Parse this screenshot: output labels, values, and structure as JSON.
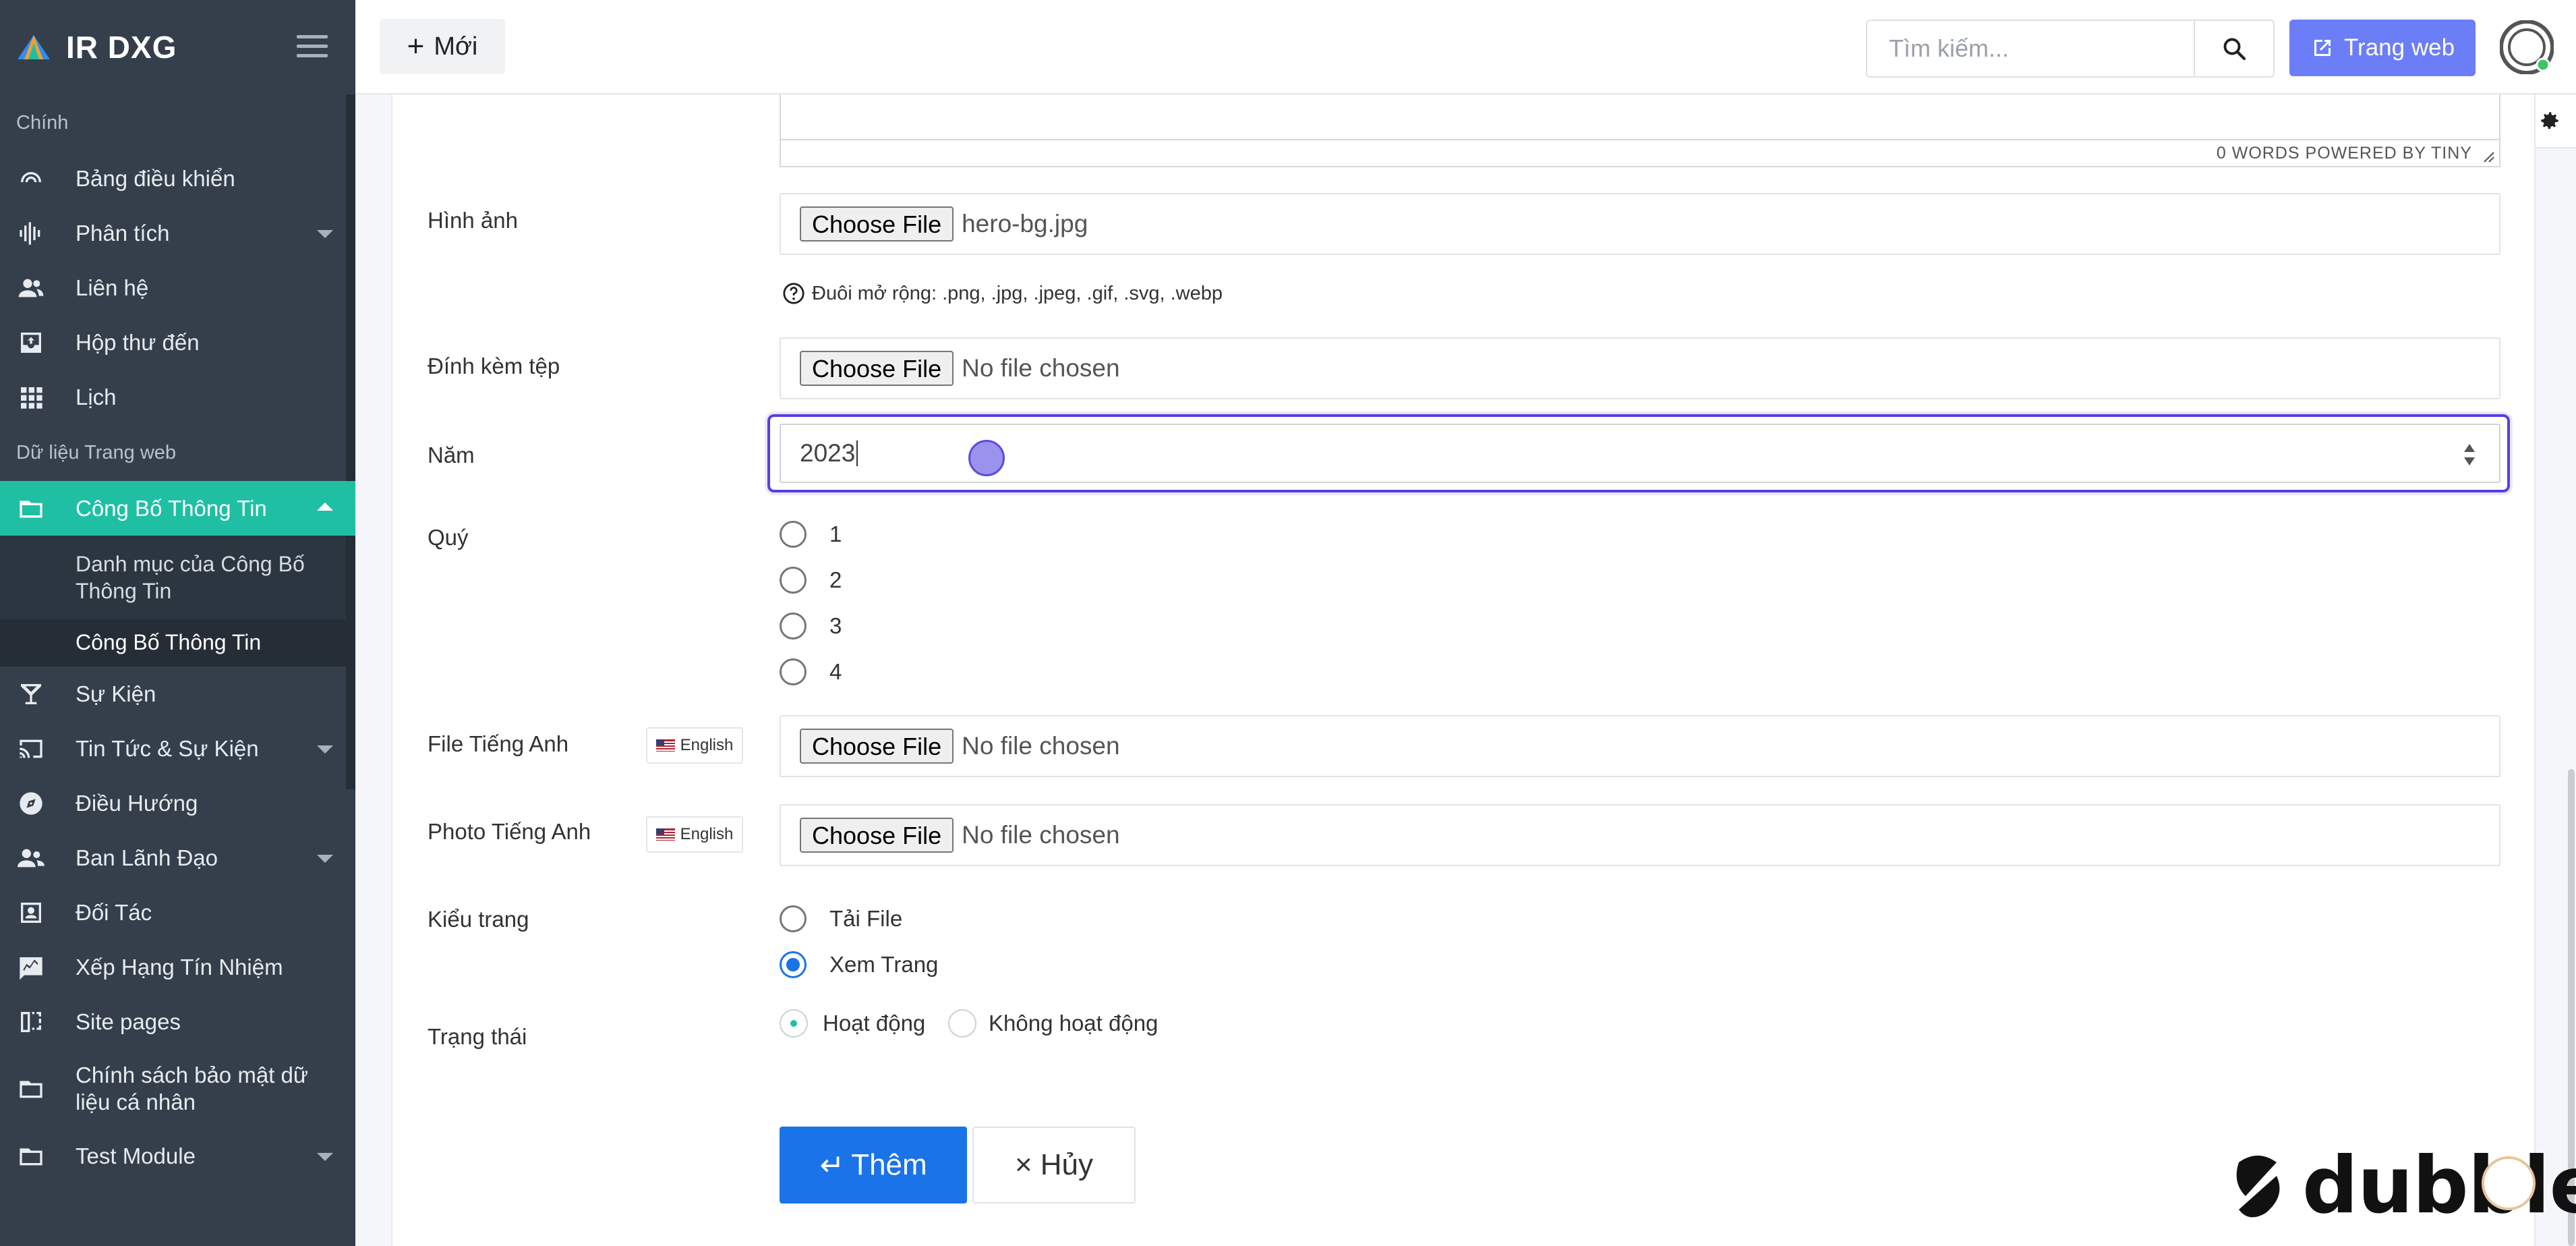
{
  "brand": {
    "name": "IR DXG"
  },
  "sidebar": {
    "section_main": "Chính",
    "main_items": [
      {
        "label": "Bảng điều khiển",
        "icon": "dashboard-icon"
      },
      {
        "label": "Phân tích",
        "icon": "analytics-icon"
      },
      {
        "label": "Liên hệ",
        "icon": "contacts-icon"
      },
      {
        "label": "Hộp thư đến",
        "icon": "inbox-icon"
      },
      {
        "label": "Lịch",
        "icon": "calendar-grid-icon"
      }
    ],
    "section_web": "Dữ liệu Trang web",
    "active_item": "Công Bố Thông Tin",
    "sub_items": [
      "Danh mục của Công Bố Thông Tin",
      "Công Bố Thông Tin"
    ],
    "web_items": [
      {
        "label": "Sự Kiện",
        "icon": "cocktail-icon"
      },
      {
        "label": "Tin Tức & Sự Kiện",
        "icon": "cast-icon"
      },
      {
        "label": "Điều Hướng",
        "icon": "compass-icon"
      },
      {
        "label": "Ban Lãnh Đạo",
        "icon": "people-icon"
      },
      {
        "label": "Đối Tác",
        "icon": "id-card-icon"
      },
      {
        "label": "Xếp Hạng Tín Nhiệm",
        "icon": "rating-icon"
      },
      {
        "label": "Site pages",
        "icon": "pages-icon"
      },
      {
        "label": "Chính sách bảo mật dữ liệu cá nhân",
        "icon": "folder-icon"
      },
      {
        "label": "Test Module",
        "icon": "folder-icon"
      }
    ]
  },
  "header": {
    "new_label": "Mới",
    "search_placeholder": "Tìm kiếm...",
    "website_label": "Trang web"
  },
  "form": {
    "editor_status": "0 WORDS  POWERED BY TINY",
    "image": {
      "label": "Hình ảnh",
      "button": "Choose File",
      "value": "hero-bg.jpg"
    },
    "hint": "Đuôi mở rộng: .png, .jpg, .jpeg, .gif, .svg, .webp",
    "attachment": {
      "label": "Đính kèm tệp",
      "button": "Choose File",
      "value": "No file chosen"
    },
    "year": {
      "label": "Năm",
      "value": "2023"
    },
    "quarter": {
      "label": "Quý",
      "options": [
        "1",
        "2",
        "3",
        "4"
      ]
    },
    "file_en": {
      "label": "File Tiếng Anh",
      "badge": "English",
      "button": "Choose File",
      "value": "No file chosen"
    },
    "photo_en": {
      "label": "Photo Tiếng Anh",
      "badge": "English",
      "button": "Choose File",
      "value": "No file chosen"
    },
    "page_type": {
      "label": "Kiểu trang",
      "options": [
        "Tải File",
        "Xem Trang"
      ],
      "selected": "Xem Trang"
    },
    "status": {
      "label": "Trạng thái",
      "options": [
        "Hoạt động",
        "Không hoạt động"
      ],
      "selected": "Hoạt động"
    },
    "submit_label": "Thêm",
    "cancel_label": "Hủy"
  },
  "watermark": "dubble",
  "colors": {
    "sidebar_bg": "#343f4b",
    "active": "#1fbfa4",
    "primary": "#1a73e8",
    "focus": "#5540e6",
    "website_btn": "#6b7ef7"
  }
}
